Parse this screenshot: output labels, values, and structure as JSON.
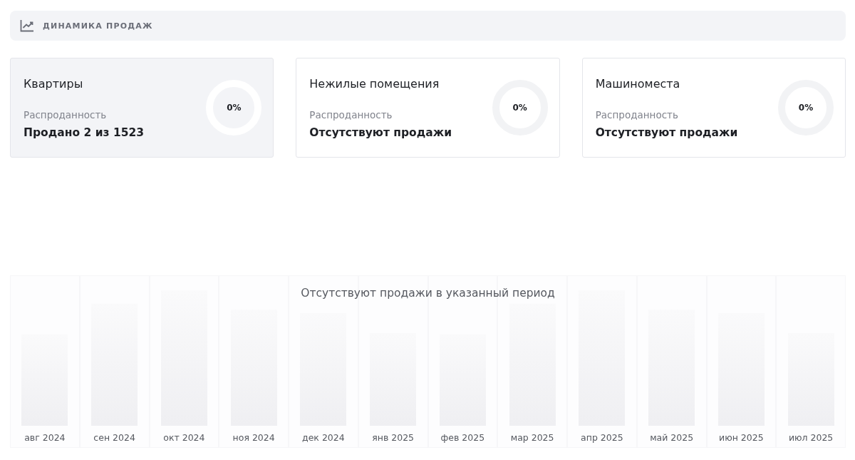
{
  "header": {
    "title": "ДИНАМИКА ПРОДАЖ"
  },
  "cards": [
    {
      "title": "Квартиры",
      "label": "Распроданность",
      "value": "Продано 2 из 1523",
      "percent": "0%",
      "selected": true
    },
    {
      "title": "Нежилые помещения",
      "label": "Распроданность",
      "value": "Отсутствуют продажи",
      "percent": "0%",
      "selected": false
    },
    {
      "title": "Машиноместа",
      "label": "Распроданность",
      "value": "Отсутствуют продажи",
      "percent": "0%",
      "selected": false
    }
  ],
  "chart": {
    "message": "Отсутствуют продажи в указанный период",
    "months": [
      "авг 2024",
      "сен 2024",
      "окт 2024",
      "ноя 2024",
      "дек 2024",
      "янв 2025",
      "фев 2025",
      "мар 2025",
      "апр 2025",
      "май 2025",
      "июн 2025",
      "июл 2025"
    ]
  }
}
